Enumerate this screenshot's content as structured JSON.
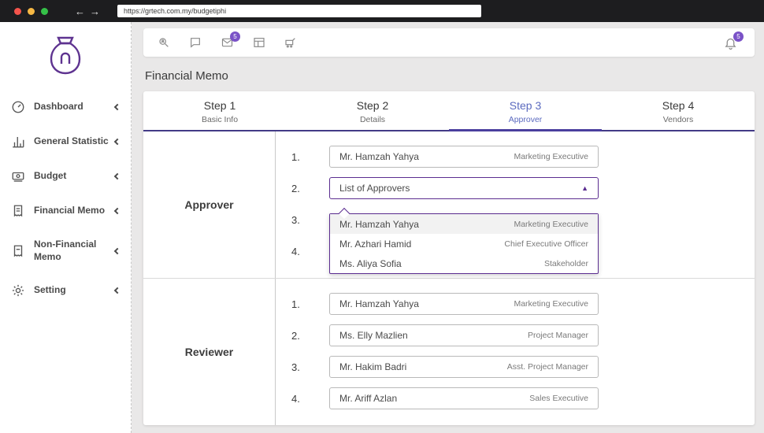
{
  "colors": {
    "accent": "#5b2d90",
    "active_step": "#5b6abf",
    "badge": "#7a52c7",
    "stepper_line": "#433b86"
  },
  "browser": {
    "url": "https://grtech.com.my/budgetiphi"
  },
  "sidebar": {
    "items": [
      {
        "label": "Dashboard",
        "icon": "dashboard-icon"
      },
      {
        "label": "General Statistic",
        "icon": "statistics-icon"
      },
      {
        "label": "Budget",
        "icon": "budget-icon"
      },
      {
        "label": "Financial Memo",
        "icon": "financial-memo-icon"
      },
      {
        "label": "Non-Financial Memo",
        "icon": "non-financial-memo-icon"
      },
      {
        "label": "Setting",
        "icon": "gear-icon"
      }
    ]
  },
  "toolbar": {
    "icons": [
      "user-search-icon",
      "comment-icon",
      "mail-icon",
      "table-icon",
      "cart-icon"
    ],
    "mail_badge": "5",
    "bell_badge": "5"
  },
  "page": {
    "title": "Financial Memo"
  },
  "stepper": {
    "steps": [
      {
        "title": "Step 1",
        "subtitle": "Basic Info"
      },
      {
        "title": "Step 2",
        "subtitle": "Details"
      },
      {
        "title": "Step 3",
        "subtitle": "Approver"
      },
      {
        "title": "Step 4",
        "subtitle": "Vendors"
      }
    ]
  },
  "approver": {
    "label": "Approver",
    "rows": [
      {
        "num": "1.",
        "name": "Mr. Hamzah Yahya",
        "role": "Marketing Executive"
      },
      {
        "num": "2."
      },
      {
        "num": "3."
      },
      {
        "num": "4."
      }
    ],
    "select_label": "List of Approvers",
    "dropdown_options": [
      {
        "name": "Mr. Hamzah Yahya",
        "role": "Marketing Executive"
      },
      {
        "name": "Mr. Azhari Hamid",
        "role": "Chief Executive Officer"
      },
      {
        "name": "Ms. Aliya Sofia",
        "role": "Stakeholder"
      }
    ]
  },
  "reviewer": {
    "label": "Reviewer",
    "rows": [
      {
        "num": "1.",
        "name": "Mr. Hamzah Yahya",
        "role": "Marketing Executive"
      },
      {
        "num": "2.",
        "name": "Ms. Elly Mazlien",
        "role": "Project Manager"
      },
      {
        "num": "3.",
        "name": "Mr. Hakim Badri",
        "role": "Asst. Project Manager"
      },
      {
        "num": "4.",
        "name": "Mr. Ariff Azlan",
        "role": "Sales Executive"
      }
    ]
  }
}
